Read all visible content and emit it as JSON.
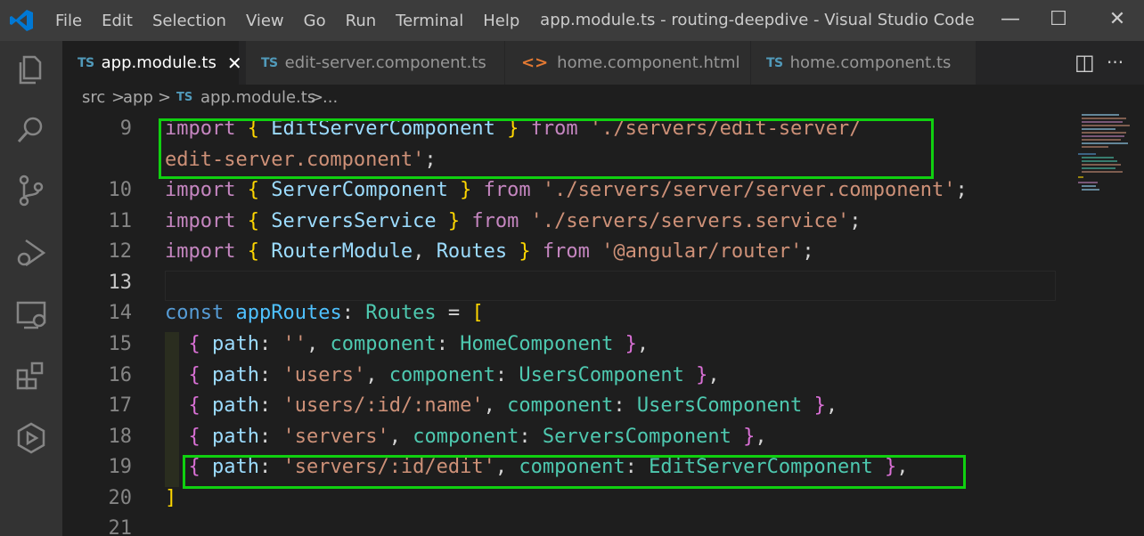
{
  "title_bar": {
    "menu": [
      "File",
      "Edit",
      "Selection",
      "View",
      "Go",
      "Run",
      "Terminal",
      "Help"
    ],
    "window_title": "app.module.ts - routing-deepdive - Visual Studio Code",
    "minimize": "—",
    "maximize": "☐",
    "close": "✕"
  },
  "activity_bar": [
    "explorer-icon",
    "search-icon",
    "source-control-icon",
    "run-debug-icon",
    "remote-explorer-icon",
    "extensions-icon",
    "live-share-icon"
  ],
  "tabs": [
    {
      "icon_text": "TS",
      "label": "app.module.ts",
      "close": "✕"
    },
    {
      "icon_text": "TS",
      "label": "edit-server.component.ts"
    },
    {
      "icon_text": "<>",
      "label": "home.component.html"
    },
    {
      "icon_text": "TS",
      "label": "home.component.ts"
    }
  ],
  "tab_actions": {
    "split": "◫",
    "more": "···"
  },
  "breadcrumb": {
    "p1": "src",
    "sep1": ">",
    "p2": "app",
    "sep2": ">",
    "file_icon": "TS",
    "file": "app.module.ts",
    "sep3": ">",
    "more": "..."
  },
  "code": {
    "line_numbers": [
      "9",
      "10",
      "11",
      "12",
      "13",
      "14",
      "15",
      "16",
      "17",
      "18",
      "19",
      "20",
      "21"
    ],
    "lines": [
      [
        {
          "t": "import",
          "c": "kw"
        },
        {
          "t": " ",
          "c": "pl"
        },
        {
          "t": "{",
          "c": "b1"
        },
        {
          "t": " ",
          "c": "pl"
        },
        {
          "t": "EditServerComponent",
          "c": "var"
        },
        {
          "t": " ",
          "c": "pl"
        },
        {
          "t": "}",
          "c": "b1"
        },
        {
          "t": " ",
          "c": "pl"
        },
        {
          "t": "from",
          "c": "kw"
        },
        {
          "t": " ",
          "c": "pl"
        },
        {
          "t": "'./servers/edit-server/",
          "c": "str"
        }
      ],
      [
        {
          "t": "edit-server.component'",
          "c": "str"
        },
        {
          "t": ";",
          "c": "pl"
        }
      ],
      [
        {
          "t": "import",
          "c": "kw"
        },
        {
          "t": " ",
          "c": "pl"
        },
        {
          "t": "{",
          "c": "b1"
        },
        {
          "t": " ",
          "c": "pl"
        },
        {
          "t": "ServerComponent",
          "c": "var"
        },
        {
          "t": " ",
          "c": "pl"
        },
        {
          "t": "}",
          "c": "b1"
        },
        {
          "t": " ",
          "c": "pl"
        },
        {
          "t": "from",
          "c": "kw"
        },
        {
          "t": " ",
          "c": "pl"
        },
        {
          "t": "'./servers/server/server.component'",
          "c": "str"
        },
        {
          "t": ";",
          "c": "pl"
        }
      ],
      [
        {
          "t": "import",
          "c": "kw"
        },
        {
          "t": " ",
          "c": "pl"
        },
        {
          "t": "{",
          "c": "b1"
        },
        {
          "t": " ",
          "c": "pl"
        },
        {
          "t": "ServersService",
          "c": "var"
        },
        {
          "t": " ",
          "c": "pl"
        },
        {
          "t": "}",
          "c": "b1"
        },
        {
          "t": " ",
          "c": "pl"
        },
        {
          "t": "from",
          "c": "kw"
        },
        {
          "t": " ",
          "c": "pl"
        },
        {
          "t": "'./servers/servers.service'",
          "c": "str"
        },
        {
          "t": ";",
          "c": "pl"
        }
      ],
      [
        {
          "t": "import",
          "c": "kw"
        },
        {
          "t": " ",
          "c": "pl"
        },
        {
          "t": "{",
          "c": "b1"
        },
        {
          "t": " ",
          "c": "pl"
        },
        {
          "t": "RouterModule",
          "c": "var"
        },
        {
          "t": ", ",
          "c": "pl"
        },
        {
          "t": "Routes",
          "c": "var"
        },
        {
          "t": " ",
          "c": "pl"
        },
        {
          "t": "}",
          "c": "b1"
        },
        {
          "t": " ",
          "c": "pl"
        },
        {
          "t": "from",
          "c": "kw"
        },
        {
          "t": " ",
          "c": "pl"
        },
        {
          "t": "'@angular/router'",
          "c": "str"
        },
        {
          "t": ";",
          "c": "pl"
        }
      ],
      [],
      [
        {
          "t": "const",
          "c": "kw2"
        },
        {
          "t": " ",
          "c": "pl"
        },
        {
          "t": "appRoutes",
          "c": "fn"
        },
        {
          "t": ": ",
          "c": "pl"
        },
        {
          "t": "Routes",
          "c": "ty"
        },
        {
          "t": " = ",
          "c": "pl"
        },
        {
          "t": "[",
          "c": "b1"
        }
      ],
      [
        {
          "t": "  ",
          "c": "pl"
        },
        {
          "t": "{",
          "c": "b2"
        },
        {
          "t": " ",
          "c": "pl"
        },
        {
          "t": "path",
          "c": "var"
        },
        {
          "t": ": ",
          "c": "pl"
        },
        {
          "t": "''",
          "c": "str"
        },
        {
          "t": ", ",
          "c": "pl"
        },
        {
          "t": "component",
          "c": "ty"
        },
        {
          "t": ": ",
          "c": "pl"
        },
        {
          "t": "HomeComponent",
          "c": "ty"
        },
        {
          "t": " ",
          "c": "pl"
        },
        {
          "t": "}",
          "c": "b2"
        },
        {
          "t": ",",
          "c": "pl"
        }
      ],
      [
        {
          "t": "  ",
          "c": "pl"
        },
        {
          "t": "{",
          "c": "b2"
        },
        {
          "t": " ",
          "c": "pl"
        },
        {
          "t": "path",
          "c": "var"
        },
        {
          "t": ": ",
          "c": "pl"
        },
        {
          "t": "'users'",
          "c": "str"
        },
        {
          "t": ", ",
          "c": "pl"
        },
        {
          "t": "component",
          "c": "ty"
        },
        {
          "t": ": ",
          "c": "pl"
        },
        {
          "t": "UsersComponent",
          "c": "ty"
        },
        {
          "t": " ",
          "c": "pl"
        },
        {
          "t": "}",
          "c": "b2"
        },
        {
          "t": ",",
          "c": "pl"
        }
      ],
      [
        {
          "t": "  ",
          "c": "pl"
        },
        {
          "t": "{",
          "c": "b2"
        },
        {
          "t": " ",
          "c": "pl"
        },
        {
          "t": "path",
          "c": "var"
        },
        {
          "t": ": ",
          "c": "pl"
        },
        {
          "t": "'users/:id/:name'",
          "c": "str"
        },
        {
          "t": ", ",
          "c": "pl"
        },
        {
          "t": "component",
          "c": "ty"
        },
        {
          "t": ": ",
          "c": "pl"
        },
        {
          "t": "UsersComponent",
          "c": "ty"
        },
        {
          "t": " ",
          "c": "pl"
        },
        {
          "t": "}",
          "c": "b2"
        },
        {
          "t": ",",
          "c": "pl"
        }
      ],
      [
        {
          "t": "  ",
          "c": "pl"
        },
        {
          "t": "{",
          "c": "b2"
        },
        {
          "t": " ",
          "c": "pl"
        },
        {
          "t": "path",
          "c": "var"
        },
        {
          "t": ": ",
          "c": "pl"
        },
        {
          "t": "'servers'",
          "c": "str"
        },
        {
          "t": ", ",
          "c": "pl"
        },
        {
          "t": "component",
          "c": "ty"
        },
        {
          "t": ": ",
          "c": "pl"
        },
        {
          "t": "ServersComponent",
          "c": "ty"
        },
        {
          "t": " ",
          "c": "pl"
        },
        {
          "t": "}",
          "c": "b2"
        },
        {
          "t": ",",
          "c": "pl"
        }
      ],
      [
        {
          "t": "  ",
          "c": "pl"
        },
        {
          "t": "{",
          "c": "b2"
        },
        {
          "t": " ",
          "c": "pl"
        },
        {
          "t": "path",
          "c": "var"
        },
        {
          "t": ": ",
          "c": "pl"
        },
        {
          "t": "'servers/:id/edit'",
          "c": "str"
        },
        {
          "t": ", ",
          "c": "pl"
        },
        {
          "t": "component",
          "c": "ty"
        },
        {
          "t": ": ",
          "c": "pl"
        },
        {
          "t": "EditServerComponent",
          "c": "ty"
        },
        {
          "t": " ",
          "c": "pl"
        },
        {
          "t": "}",
          "c": "b2"
        },
        {
          "t": ",",
          "c": "pl"
        }
      ],
      [
        {
          "t": "]",
          "c": "b1"
        }
      ],
      []
    ]
  },
  "colors": {
    "highlight_box": "#10d010",
    "string": "#ce9178",
    "keyword": "#c586c0",
    "variable": "#9cdcfe",
    "type": "#4ec9b0",
    "bracket": "#ffd700"
  }
}
